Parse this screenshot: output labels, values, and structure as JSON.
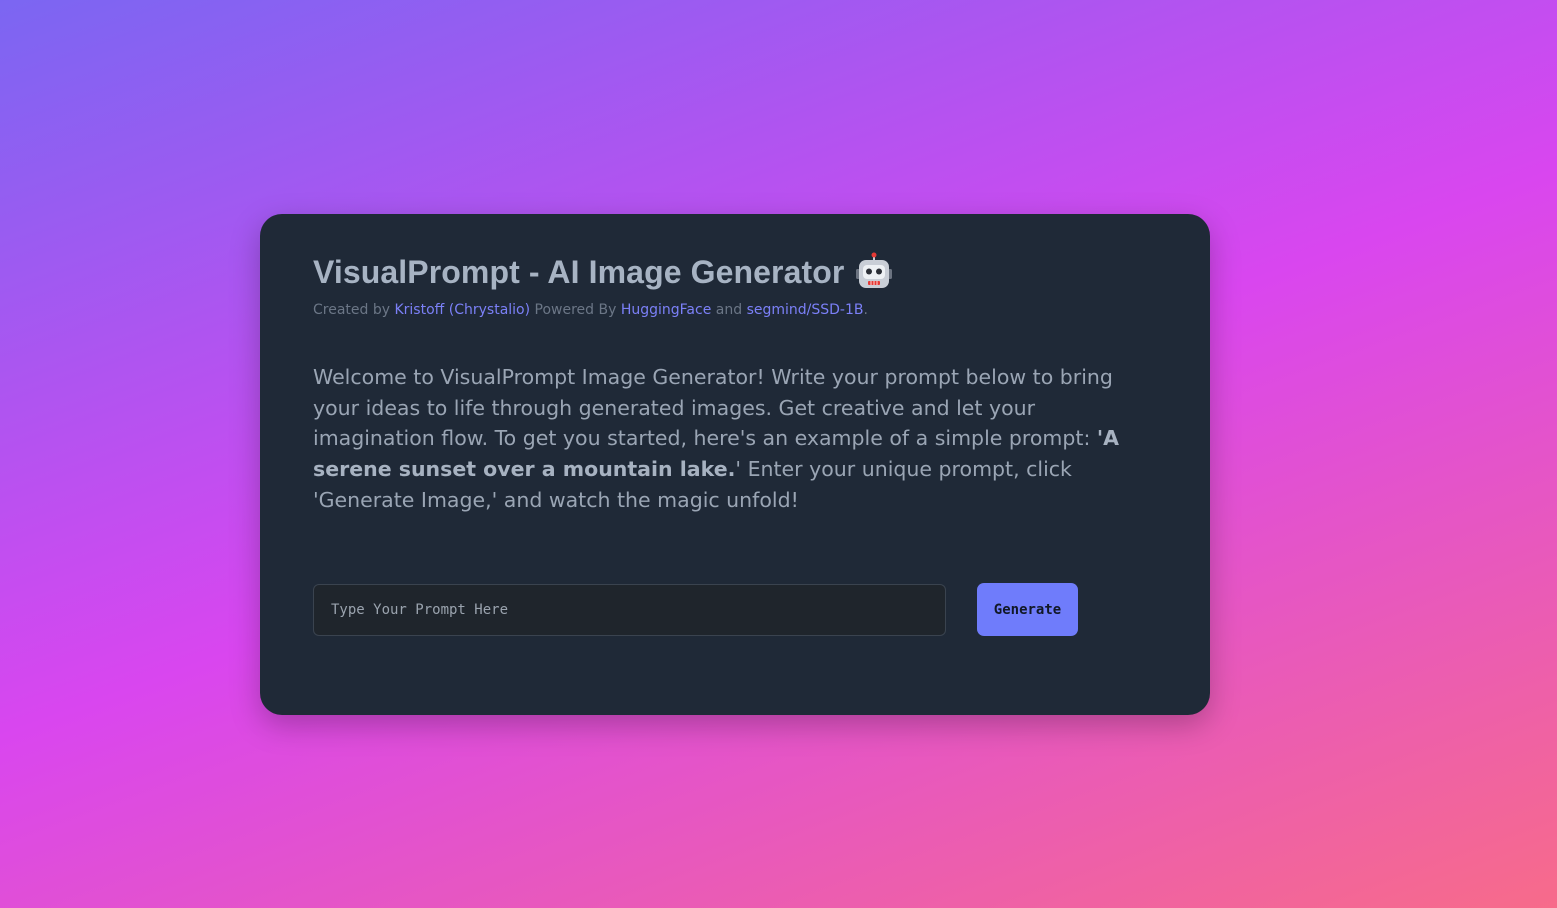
{
  "header": {
    "title": "VisualPrompt - AI Image Generator",
    "title_icon": "robot-icon",
    "credits": {
      "created_by_prefix": "Created by ",
      "author_link": "Kristoff (Chrystalio)",
      "powered_by_text": " Powered By ",
      "huggingface_link": "HuggingFace",
      "and_text": " and ",
      "model_link": "segmind/SSD-1B",
      "trailing_period": "."
    }
  },
  "welcome": {
    "intro": "Welcome to VisualPrompt Image Generator! Write your prompt below to bring your ideas to life through generated images. Get creative and let your imagination flow. To get you started, here's an example of a simple prompt: ",
    "example": "'A serene sunset over a mountain lake.",
    "outro": "' Enter your unique prompt, click 'Generate Image,' and watch the magic unfold!"
  },
  "form": {
    "prompt_value": "",
    "prompt_placeholder": "Type Your Prompt Here",
    "generate_label": "Generate"
  },
  "colors": {
    "card_background": "#1f2937",
    "accent": "#6f7cfb",
    "link": "#7b80f7",
    "gradient_start": "#7b66f2",
    "gradient_mid": "#d946ef",
    "gradient_end": "#f76b8a"
  }
}
